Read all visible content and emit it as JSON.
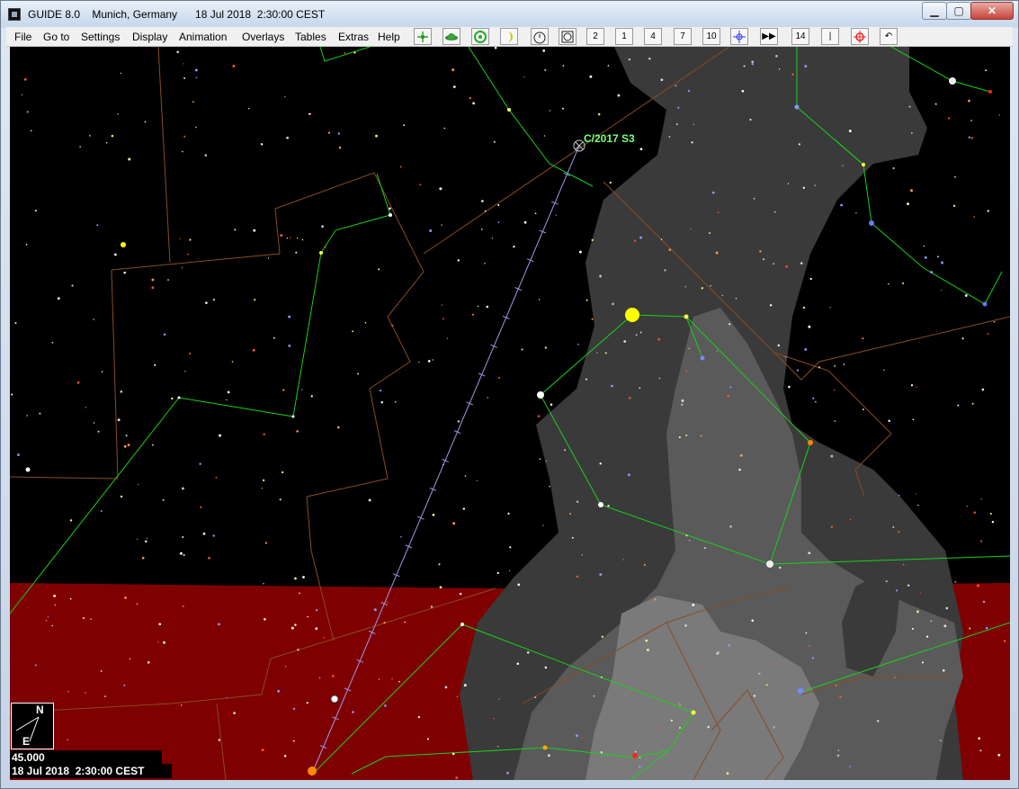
{
  "window": {
    "title": "GUIDE 8.0    Munich, Germany      18 Jul 2018  2:30:00 CEST",
    "minimize_glyph": "▁",
    "maximize_glyph": "▢",
    "close_glyph": "✕"
  },
  "menu": {
    "file": "File",
    "goto": "Go to",
    "settings": "Settings",
    "display": "Display",
    "animation": "Animation",
    "overlays": "Overlays",
    "tables": "Tables",
    "extras": "Extras",
    "help": "Help"
  },
  "toolbar": {
    "icons": [
      {
        "name": "star-chart-icon",
        "glyph": ""
      },
      {
        "name": "planet-icon",
        "glyph": ""
      },
      {
        "name": "sun-icon",
        "glyph": ""
      },
      {
        "name": "moon-icon",
        "glyph": ""
      },
      {
        "name": "timer-icon",
        "glyph": ""
      },
      {
        "name": "clock-icon",
        "glyph": ""
      },
      {
        "name": "level-2-icon",
        "glyph": "2"
      },
      {
        "name": "level-1-icon",
        "glyph": "1"
      },
      {
        "name": "level-4-icon",
        "glyph": "4"
      },
      {
        "name": "level-7-icon",
        "glyph": "7"
      },
      {
        "name": "level-10-icon",
        "glyph": "10"
      },
      {
        "name": "object-search-icon",
        "glyph": ""
      },
      {
        "name": "fast-forward-icon",
        "glyph": "▶▶"
      },
      {
        "name": "level-14-icon",
        "glyph": "14"
      },
      {
        "name": "bar-icon",
        "glyph": "|"
      },
      {
        "name": "crosshair-icon",
        "glyph": ""
      },
      {
        "name": "undo-icon",
        "glyph": "↶"
      }
    ]
  },
  "chart": {
    "comet_label": "C/2017 S3",
    "compass_n": "N",
    "compass_e": "E",
    "field_of_view": "45.000",
    "datetime": "18 Jul 2018  2:30:00 CEST",
    "colors": {
      "sky": "#000000",
      "horizon": "#7f0000",
      "milky_way_1": "#3a3a3a",
      "milky_way_2": "#5a5a5a",
      "milky_way_3": "#7a7a7a",
      "constellation_lines": "#19d119",
      "constellation_boundaries": "#8a4b22",
      "comet_path": "#9a9ae6"
    }
  }
}
